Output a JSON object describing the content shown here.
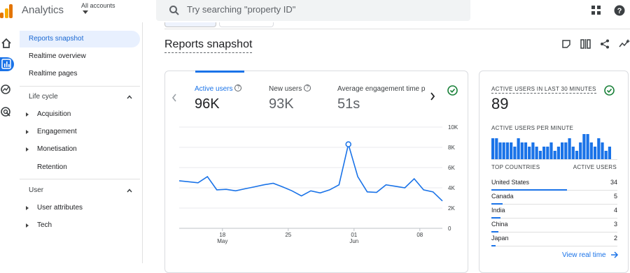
{
  "app": {
    "title": "Analytics",
    "account_label": "All accounts"
  },
  "search": {
    "placeholder": "Try searching \"property ID\""
  },
  "nav": {
    "items": [
      {
        "label": "Reports snapshot",
        "selected": true
      },
      {
        "label": "Realtime overview"
      },
      {
        "label": "Realtime pages"
      }
    ],
    "sections": [
      {
        "label": "Life cycle",
        "children": [
          "Acquisition",
          "Engagement",
          "Monetisation",
          "Retention"
        ]
      },
      {
        "label": "User",
        "children": [
          "User attributes",
          "Tech"
        ]
      }
    ]
  },
  "page": {
    "title": "Reports snapshot"
  },
  "metrics": [
    {
      "label": "Active users",
      "value": "96K"
    },
    {
      "label": "New users",
      "value": "93K"
    },
    {
      "label": "Average engagement time p",
      "value": "51s"
    }
  ],
  "chart_data": {
    "type": "line",
    "x": [
      1,
      2,
      3,
      4,
      5,
      6,
      7,
      8,
      9,
      10,
      11,
      12,
      13,
      14,
      15,
      16,
      17,
      18,
      19,
      20,
      21,
      22,
      23,
      24,
      25,
      26,
      27,
      28,
      29
    ],
    "series": [
      {
        "values": [
          4700,
          4600,
          4500,
          5100,
          3800,
          3850,
          3700,
          3900,
          4100,
          4300,
          4450,
          4100,
          3700,
          3200,
          3700,
          3500,
          3800,
          4300,
          8300,
          5100,
          3600,
          3550,
          4300,
          4150,
          4000,
          4900,
          3800,
          3600,
          2700
        ]
      }
    ],
    "ylim": [
      0,
      10000
    ],
    "yticks": [
      "10K",
      "8K",
      "6K",
      "4K",
      "2K",
      "0"
    ],
    "xticks": [
      {
        "day": "18",
        "month": "May"
      },
      {
        "day": "25",
        "month": ""
      },
      {
        "day": "01",
        "month": "Jun"
      },
      {
        "day": "08",
        "month": ""
      }
    ],
    "highlight_index": 18,
    "grid": true
  },
  "realtime": {
    "title": "ACTIVE USERS IN LAST 30 MINUTES",
    "value": "89",
    "per_minute_label": "ACTIVE USERS PER MINUTE",
    "per_minute": [
      5,
      5,
      4,
      4,
      4,
      4,
      3,
      5,
      4,
      4,
      3,
      4,
      3,
      2,
      3,
      3,
      4,
      2,
      3,
      4,
      4,
      5,
      3,
      2,
      4,
      6,
      6,
      4,
      3,
      5,
      4,
      2,
      3
    ],
    "col_country": "TOP COUNTRIES",
    "col_users": "ACTIVE USERS",
    "countries": [
      {
        "name": "United States",
        "users": "34"
      },
      {
        "name": "Canada",
        "users": "5"
      },
      {
        "name": "India",
        "users": "4"
      },
      {
        "name": "China",
        "users": "3"
      },
      {
        "name": "Japan",
        "users": "2"
      }
    ],
    "view_link": "View real time"
  },
  "colors": {
    "accent": "#1a73e8",
    "success": "#188038",
    "line": "#1a73e8"
  }
}
